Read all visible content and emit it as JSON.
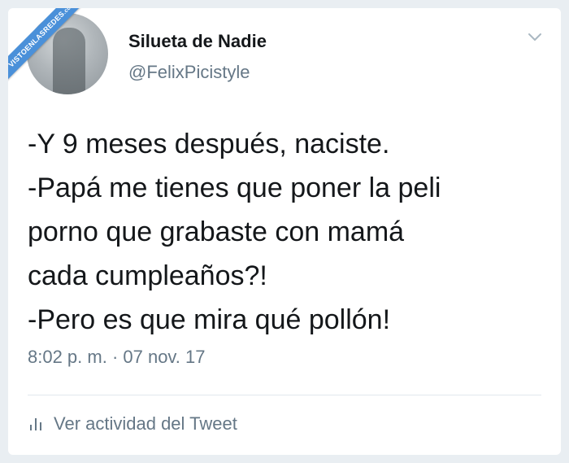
{
  "watermark": {
    "text": "VISTOENLASREDES",
    "sub": ".com"
  },
  "author": {
    "name": "Silueta de Nadie",
    "handle": "@FelixPicistyle"
  },
  "tweet": {
    "lines": [
      "-Y 9 meses después, naciste.",
      "-Papá me tienes que poner la peli",
      "porno que grabaste con mamá",
      "cada cumpleaños?!",
      "-Pero es que mira qué pollón!"
    ],
    "timestamp": "8:02 p. m. · 07 nov. 17"
  },
  "actions": {
    "activity_label": "Ver actividad del Tweet",
    "activity_icon": "bar-chart-icon",
    "menu_icon": "chevron-down-icon"
  },
  "colors": {
    "text": "#14171a",
    "secondary": "#657786",
    "ribbon": "#4a90d9"
  }
}
